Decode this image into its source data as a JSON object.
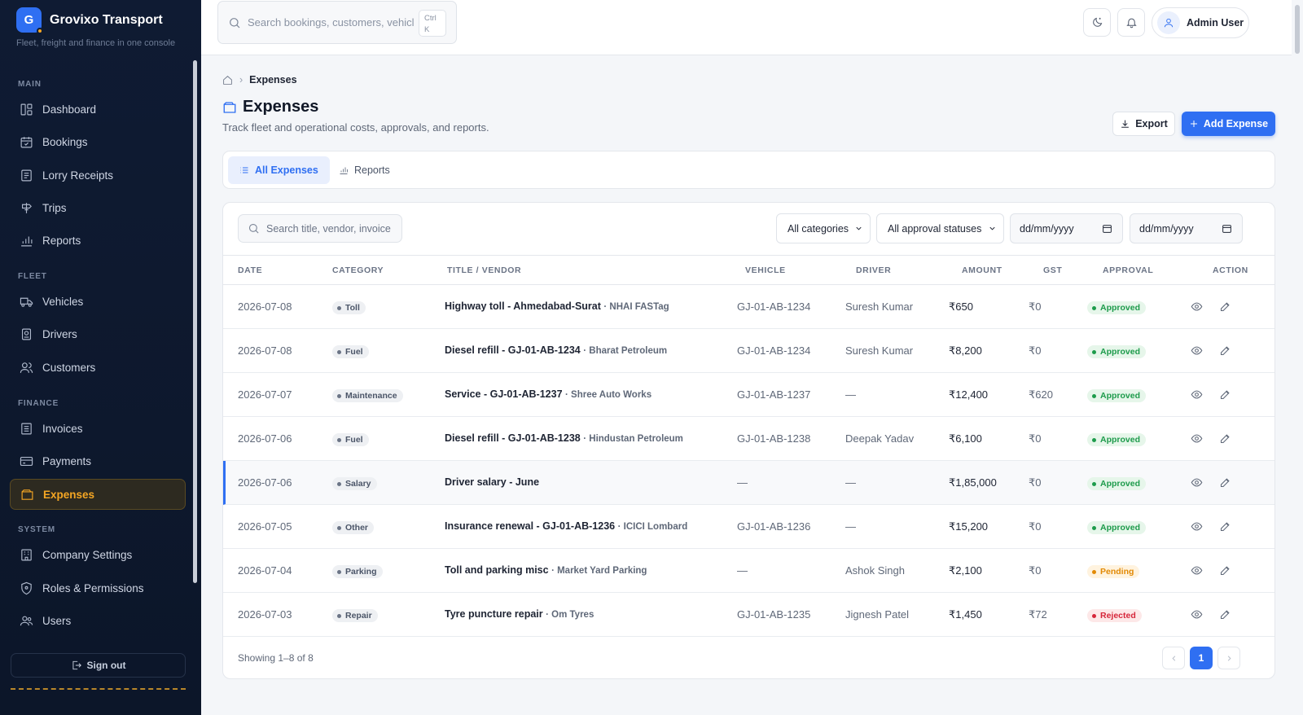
{
  "app": {
    "logo_letter": "G",
    "name": "Grovixo Transport",
    "tagline": "Fleet, freight and finance in one console"
  },
  "sidebar": {
    "sections": [
      "MAIN",
      "FLEET",
      "FINANCE",
      "SYSTEM"
    ],
    "items": [
      {
        "label": "Dashboard",
        "icon": "dashboard-icon"
      },
      {
        "label": "Bookings",
        "icon": "calendar-check-icon"
      },
      {
        "label": "Lorry Receipts",
        "icon": "receipt-icon"
      },
      {
        "label": "Trips",
        "icon": "signpost-icon"
      },
      {
        "label": "Reports",
        "icon": "bar-chart-icon"
      },
      {
        "label": "Vehicles",
        "icon": "truck-icon"
      },
      {
        "label": "Drivers",
        "icon": "id-badge-icon"
      },
      {
        "label": "Customers",
        "icon": "users-icon"
      },
      {
        "label": "Invoices",
        "icon": "invoice-icon"
      },
      {
        "label": "Payments",
        "icon": "credit-card-icon"
      },
      {
        "label": "Expenses",
        "icon": "wallet-icon",
        "active": true
      },
      {
        "label": "Company Settings",
        "icon": "building-icon"
      },
      {
        "label": "Roles & Permissions",
        "icon": "shield-icon"
      },
      {
        "label": "Users",
        "icon": "user-group-icon"
      }
    ],
    "sign_out": "Sign out"
  },
  "topbar": {
    "search_placeholder": "Search bookings, customers, vehicles",
    "shortcut_line1": "Ctrl",
    "shortcut_line2": "K",
    "user_name": "Admin User"
  },
  "page": {
    "breadcrumb": "Expenses",
    "title": "Expenses",
    "subtitle": "Track fleet and operational costs, approvals, and reports.",
    "export_label": "Export",
    "add_label": "Add Expense",
    "tabs": [
      "All Expenses",
      "Reports"
    ]
  },
  "filters": {
    "search_placeholder": "Search title, vendor, invoice",
    "category": "All categories",
    "approval": "All approval statuses",
    "date_from": "dd/mm/yyyy",
    "date_to": "dd/mm/yyyy"
  },
  "table": {
    "columns": [
      "DATE",
      "CATEGORY",
      "TITLE / VENDOR",
      "VEHICLE",
      "DRIVER",
      "AMOUNT",
      "GST",
      "APPROVAL",
      "ACTION"
    ],
    "rows": [
      {
        "date": "2026-07-08",
        "category": "Toll",
        "title": "Highway toll - Ahmedabad-Surat",
        "vendor": "· NHAI FASTag",
        "vehicle": "GJ-01-AB-1234",
        "driver": "Suresh Kumar",
        "amount": "₹650",
        "gst": "₹0",
        "approval": "Approved"
      },
      {
        "date": "2026-07-08",
        "category": "Fuel",
        "title": "Diesel refill - GJ-01-AB-1234",
        "vendor": "· Bharat Petroleum",
        "vehicle": "GJ-01-AB-1234",
        "driver": "Suresh Kumar",
        "amount": "₹8,200",
        "gst": "₹0",
        "approval": "Approved"
      },
      {
        "date": "2026-07-07",
        "category": "Maintenance",
        "title": "Service - GJ-01-AB-1237",
        "vendor": "· Shree Auto Works",
        "vehicle": "GJ-01-AB-1237",
        "driver": "—",
        "amount": "₹12,400",
        "gst": "₹620",
        "approval": "Approved"
      },
      {
        "date": "2026-07-06",
        "category": "Fuel",
        "title": "Diesel refill - GJ-01-AB-1238",
        "vendor": "· Hindustan Petroleum",
        "vehicle": "GJ-01-AB-1238",
        "driver": "Deepak Yadav",
        "amount": "₹6,100",
        "gst": "₹0",
        "approval": "Approved"
      },
      {
        "date": "2026-07-06",
        "category": "Salary",
        "title": "Driver salary - June",
        "vendor": "",
        "vehicle": "—",
        "driver": "—",
        "amount": "₹1,85,000",
        "gst": "₹0",
        "approval": "Approved"
      },
      {
        "date": "2026-07-05",
        "category": "Other",
        "title": "Insurance renewal - GJ-01-AB-1236",
        "vendor": "· ICICI Lombard",
        "vehicle": "GJ-01-AB-1236",
        "driver": "—",
        "amount": "₹15,200",
        "gst": "₹0",
        "approval": "Approved"
      },
      {
        "date": "2026-07-04",
        "category": "Parking",
        "title": "Toll and parking misc",
        "vendor": "· Market Yard Parking",
        "vehicle": "—",
        "driver": "Ashok Singh",
        "amount": "₹2,100",
        "gst": "₹0",
        "approval": "Pending"
      },
      {
        "date": "2026-07-03",
        "category": "Repair",
        "title": "Tyre puncture repair",
        "vendor": "· Om Tyres",
        "vehicle": "GJ-01-AB-1235",
        "driver": "Jignesh Patel",
        "amount": "₹1,450",
        "gst": "₹72",
        "approval": "Rejected"
      }
    ],
    "footer": "Showing 1–8 of 8",
    "current_page": "1"
  },
  "colors": {
    "accent": "#2f6ff2",
    "sidebar_bg": "#0f1b33",
    "active_nav": "#f5a623",
    "approved": "#1d9b4b",
    "pending": "#e28a05",
    "rejected": "#d6263a"
  }
}
